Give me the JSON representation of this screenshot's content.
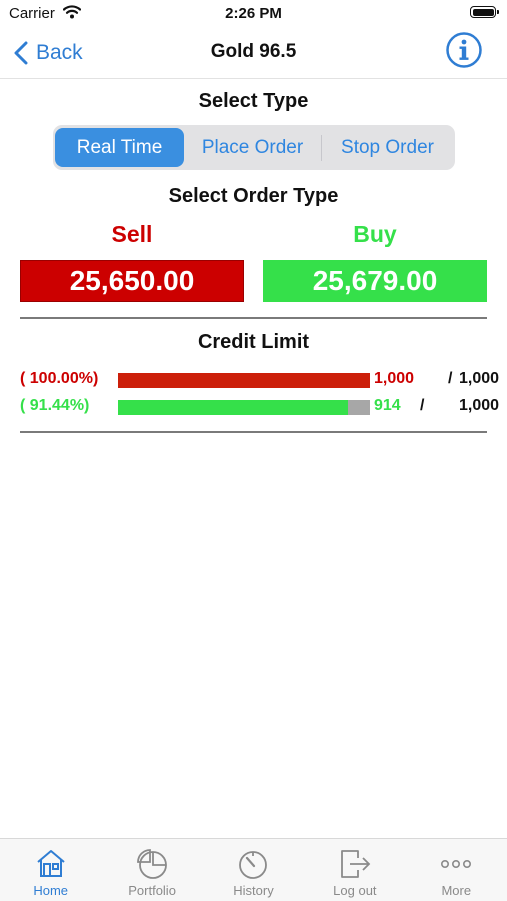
{
  "status_bar": {
    "carrier": "Carrier",
    "time": "2:26 PM"
  },
  "nav": {
    "back_label": "Back",
    "title": "Gold 96.5"
  },
  "select_type": {
    "heading": "Select Type",
    "options": [
      "Real Time",
      "Place Order",
      "Stop Order"
    ],
    "selected": "Real Time"
  },
  "order_type": {
    "heading": "Select Order Type",
    "sell": {
      "label": "Sell",
      "price": "25,650.00"
    },
    "buy": {
      "label": "Buy",
      "price": "25,679.00"
    }
  },
  "credit_limit": {
    "heading": "Credit Limit",
    "rows": [
      {
        "percent_text": "( 100.00%)",
        "fraction": 1.0,
        "used": "1,000",
        "separator": "/",
        "total": "1,000",
        "color": "#cc1f0a"
      },
      {
        "percent_text": "( 91.44%)",
        "fraction": 0.9144,
        "used": "914",
        "separator": "/",
        "total": "1,000",
        "color": "#35e04a"
      }
    ]
  },
  "colors": {
    "accent": "#2f7dd3",
    "sell": "#cc0000",
    "buy": "#35e04a"
  },
  "tab_bar": {
    "tabs": [
      {
        "label": "Home",
        "icon": "home-icon",
        "active": true
      },
      {
        "label": "Portfolio",
        "icon": "pie-chart-icon",
        "active": false
      },
      {
        "label": "History",
        "icon": "timer-icon",
        "active": false
      },
      {
        "label": "Log out",
        "icon": "logout-icon",
        "active": false
      },
      {
        "label": "More",
        "icon": "more-icon",
        "active": false
      }
    ]
  }
}
